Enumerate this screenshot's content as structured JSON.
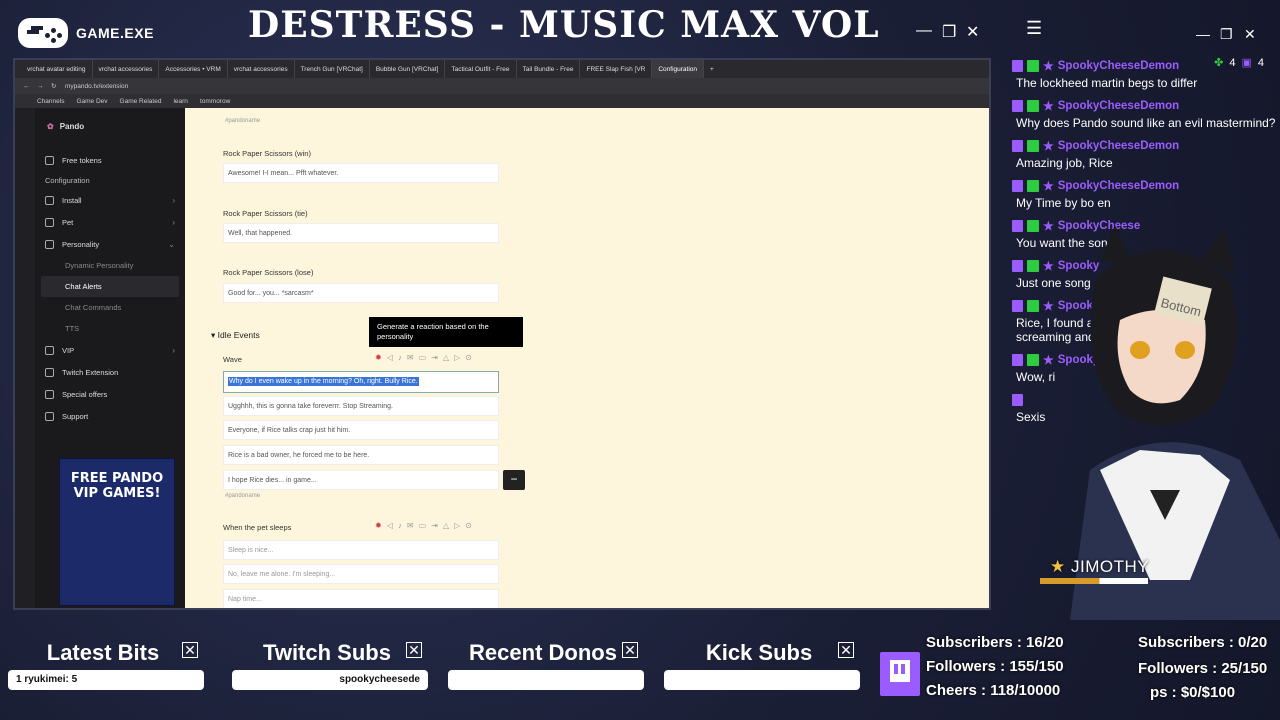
{
  "overlay": {
    "app_name": "GAME.EXE",
    "stream_title": "DESTRESS - MUSIC MAX VOL"
  },
  "browser": {
    "tabs": [
      "vrchat avatar editing",
      "vrchat accessories",
      "Accessories • VRM",
      "vrchat accessories",
      "Trench Gun [VRChat]",
      "Bubble Gun [VRChat]",
      "Tactical Outfit - Free",
      "Tail Bundle - Free",
      "FREE Slap Fish [VR",
      "Configuration"
    ],
    "url": "mypando.tv/extension",
    "bookmarks": [
      "Channels",
      "Game Dev",
      "Game Related",
      "learn",
      "tommorow"
    ]
  },
  "sidebar": {
    "brand": "Pando",
    "items": [
      {
        "label": "Free tokens"
      },
      {
        "label": "Configuration"
      },
      {
        "label": "Install"
      },
      {
        "label": "Pet"
      },
      {
        "label": "Personality"
      }
    ],
    "sub_items": [
      "Dynamic Personality",
      "Chat Alerts",
      "Chat Commands",
      "TTS"
    ],
    "items2": [
      "VIP",
      "Twitch Extension",
      "Special offers",
      "Support"
    ],
    "promo": "FREE PANDO VIP GAMES!"
  },
  "main": {
    "pandoname_top": "#pandoname",
    "rps_win_label": "Rock Paper Scissors (win)",
    "rps_win_value": "Awesome! I-I mean... Pfft whatever.",
    "rps_tie_label": "Rock Paper Scissors (tie)",
    "rps_tie_value": "Well, that happened.",
    "rps_lose_label": "Rock Paper Scissors (lose)",
    "rps_lose_value": "Good for... you... *sarcasm*",
    "idle_section": "Idle Events",
    "tooltip": "Generate a reaction based on the personality",
    "wave_label": "Wave",
    "wave_selected": "Why do I even wake up in the morning? Oh, right. Bully Rice.",
    "wave_values": [
      "Ugghhh, this is gonna take foreverrr. Stop Streaming.",
      "Everyone, if Rice talks crap just hit him.",
      "Rice is a bad owner, he forced me to be here.",
      "I hope Rice dies... in game..."
    ],
    "pandoname_bottom": "#pandoname",
    "sleep_label": "When the pet sleeps",
    "sleep_values": [
      "Sleep is nice...",
      "No, leave me alone. I'm sleeping...",
      "Nap time..."
    ],
    "remove_button": "−"
  },
  "chat": {
    "top_counts": [
      "4",
      "4"
    ],
    "messages": [
      {
        "user": "SpookyCheeseDemon",
        "text": "The lockheed martin begs to differ"
      },
      {
        "user": "SpookyCheeseDemon",
        "text": "Why does Pando sound like an evil mastermind?"
      },
      {
        "user": "SpookyCheeseDemon",
        "text": "Amazing job, Rice"
      },
      {
        "user": "SpookyCheeseDemon",
        "text": "My Time by bo en"
      },
      {
        "user": "SpookyCheese",
        "text": "You want the song?"
      },
      {
        "user": "Spooky",
        "text": "Just one song"
      },
      {
        "user": "Spook",
        "text": "Rice, I found a screaming and el"
      },
      {
        "user": "SpookyC",
        "text": "Wow, ri"
      },
      {
        "user": "",
        "text": "Sexis"
      }
    ]
  },
  "vtuber": {
    "name": "JIMOTHY",
    "sign": "Bottom"
  },
  "panels": [
    {
      "title": "Latest Bits",
      "content": "1  ryukimei:  5"
    },
    {
      "title": "Twitch Subs",
      "content": "spookycheesede"
    },
    {
      "title": "Recent Donos",
      "content": ""
    },
    {
      "title": "Kick Subs",
      "content": ""
    }
  ],
  "stats": {
    "twitch_subs": "Subscribers : 16/20",
    "twitch_followers": "Followers : 155/150",
    "cheers": "Cheers : 118/10000",
    "kick_subs": "Subscribers : 0/20",
    "kick_followers": "Followers : 25/150",
    "tips": "ps : $0/$100"
  },
  "colors": {
    "accent": "#9b5cff",
    "main_bg": "#fdf6dc",
    "selection": "#3a74d6"
  }
}
